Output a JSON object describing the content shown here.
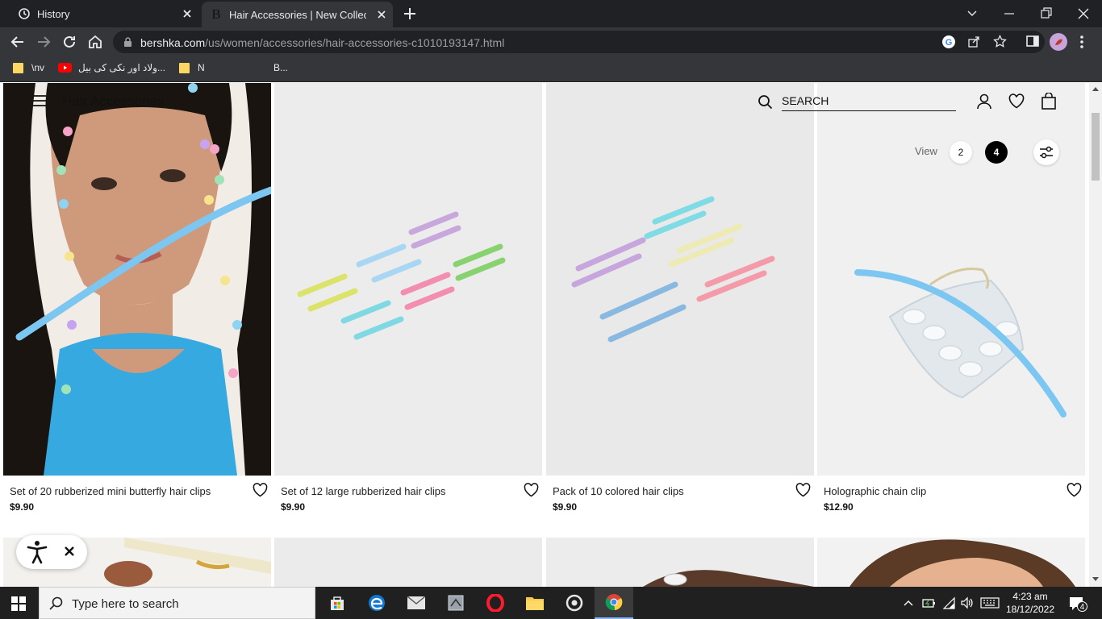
{
  "browser": {
    "tabs": [
      {
        "label": "History",
        "active": false
      },
      {
        "label": "Hair Accessories | New Collection",
        "active": true
      }
    ],
    "url_host": "bershka.com",
    "url_path": "/us/women/accessories/hair-accessories-c1010193147.html",
    "bookmarks": [
      {
        "label": "\\nv",
        "icon": "folder-icon"
      },
      {
        "label": "ولاد اور نکی کی بیل...",
        "icon": "youtube-icon"
      },
      {
        "label": "N",
        "icon": "folder-icon"
      },
      {
        "label": "B...",
        "icon": "none"
      }
    ]
  },
  "site": {
    "page_title": "Hair Accessories",
    "search_label": "SEARCH",
    "view_label": "View",
    "view_options": [
      "2",
      "4"
    ],
    "view_selected": "4",
    "products": [
      {
        "name": "Set of 20 rubberized mini butterfly hair clips",
        "price": "$9.90"
      },
      {
        "name": "Set of 12 large rubberized hair clips",
        "price": "$9.90"
      },
      {
        "name": "Pack of 10 colored hair clips",
        "price": "$9.90"
      },
      {
        "name": "Holographic chain clip",
        "price": "$12.90"
      }
    ]
  },
  "taskbar": {
    "search_placeholder": "Type here to search",
    "time": "4:23 am",
    "date": "18/12/2022",
    "notifications": "4"
  },
  "colors": {
    "accent_scribble": "#7cc6f2",
    "chrome_dark": "#202124",
    "chrome_toolbar": "#35363a",
    "active_view": "#000000"
  }
}
